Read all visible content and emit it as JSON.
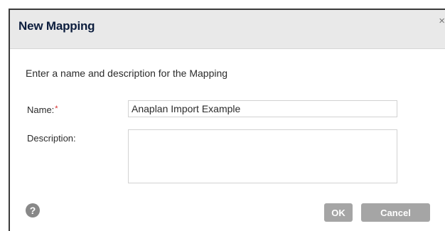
{
  "dialog": {
    "title": "New Mapping",
    "close_glyph": "×",
    "instructions": "Enter a name and description for the Mapping",
    "name_label": "Name:",
    "required_marker": "*",
    "name_value": "Anaplan Import Example",
    "description_label": "Description:",
    "description_value": "",
    "help_glyph": "?",
    "ok_label": "OK",
    "cancel_label": "Cancel"
  },
  "icons": {
    "close": "close-icon",
    "help": "help-icon"
  },
  "colors": {
    "title_text": "#0d1e3e",
    "titlebar_bg": "#e9e9e9",
    "required": "#d52b2b",
    "button_bg": "#a5a5a5",
    "help_icon_bg": "#888888"
  }
}
